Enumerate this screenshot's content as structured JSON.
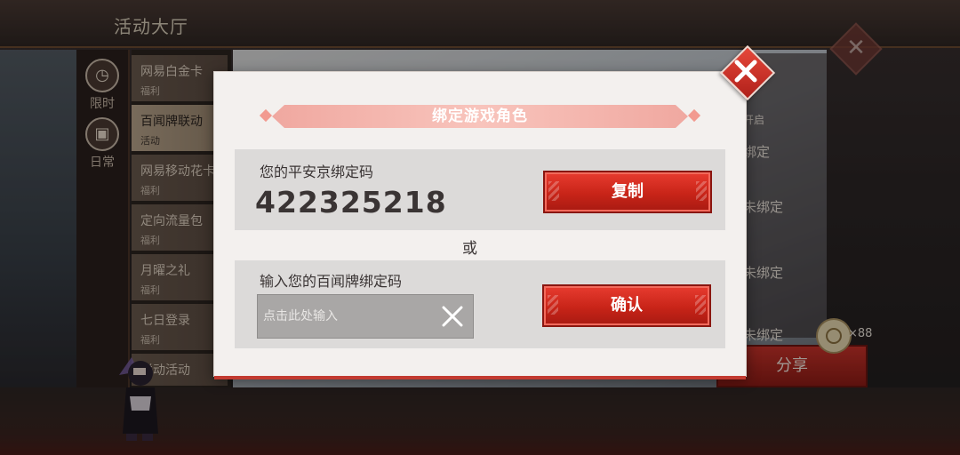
{
  "background": {
    "hall_title": "活动大厅",
    "side_tabs": [
      {
        "label": "限时",
        "icon": "clock-icon"
      },
      {
        "label": "日常",
        "icon": "gift-icon"
      }
    ],
    "menu_items": [
      {
        "title": "网易白金卡",
        "subtitle": "福利"
      },
      {
        "title": "百闻牌联动",
        "subtitle": "活动"
      },
      {
        "title": "网易移动花卡",
        "subtitle": "福利"
      },
      {
        "title": "定向流量包",
        "subtitle": "福利"
      },
      {
        "title": "月曜之礼",
        "subtitle": "福利"
      },
      {
        "title": "七日登录",
        "subtitle": "福利"
      },
      {
        "title": "联动活动",
        "subtitle": ""
      }
    ],
    "right_panel": {
      "open_text": "开启",
      "bind_tag": "绑定",
      "unbound_1": "未绑定",
      "unbound_2": "未绑定",
      "unbound_3": "未绑定"
    },
    "coin_count": "×88",
    "share_label": "分享"
  },
  "dialog": {
    "title": "绑定游戏角色",
    "code_label": "您的平安京绑定码",
    "code_value": "422325218",
    "copy_label": "复制",
    "or_label": "或",
    "input_label": "输入您的百闻牌绑定码",
    "input_placeholder": "点击此处输入",
    "input_value": "",
    "confirm_label": "确认"
  },
  "colors": {
    "accent_red": "#c82418",
    "banner_pink": "#f8c4bc",
    "dialog_bg": "#f3f0ee"
  }
}
